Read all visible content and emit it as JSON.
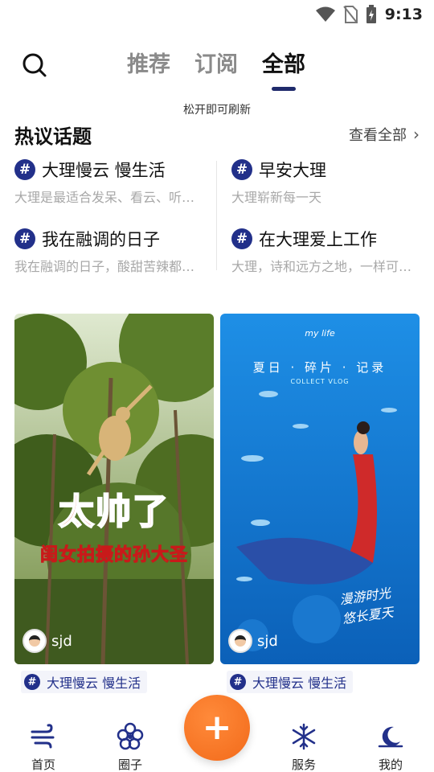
{
  "status_bar": {
    "time": "9:13"
  },
  "top_nav": {
    "tabs": [
      {
        "label": "推荐"
      },
      {
        "label": "订阅"
      },
      {
        "label": "全部"
      }
    ],
    "active_tab": 2
  },
  "refresh_tip": "松开即可刷新",
  "hot_topics": {
    "title": "热议话题",
    "view_all": "查看全部",
    "items": [
      {
        "title": "大理慢云 慢生活",
        "desc": "大理是最适合发呆、看云、听风的地方"
      },
      {
        "title": "早安大理",
        "desc": "大理崭新每一天"
      },
      {
        "title": "我在融调的日子",
        "desc": "我在融调的日子，酸甜苦辣都是回忆"
      },
      {
        "title": "在大理爱上工作",
        "desc": "大理，诗和远方之地，一样可以努力工作"
      }
    ]
  },
  "cards": [
    {
      "overlay_line1": "太帅了",
      "overlay_line2": "闺女拍摄的孙大圣",
      "username": "sjd",
      "tag": "大理慢云 慢生活"
    },
    {
      "brand": "my life",
      "overlay_title": "夏日 · 碎片 · 记录",
      "overlay_sub": "COLLECT VLOG",
      "hand_line1": "漫游时光",
      "hand_line2": "悠长夏天",
      "username": "sjd",
      "tag": "大理慢云 慢生活"
    }
  ],
  "bottom_nav": {
    "items": [
      {
        "label": "首页",
        "icon": "wind-icon"
      },
      {
        "label": "圈子",
        "icon": "flower-icon"
      },
      {
        "label": "服务",
        "icon": "snowflake-icon"
      },
      {
        "label": "我的",
        "icon": "moon-icon"
      }
    ],
    "fab_icon": "plus-icon"
  },
  "colors": {
    "accent": "#22308a",
    "fab": "#f26a1a"
  }
}
